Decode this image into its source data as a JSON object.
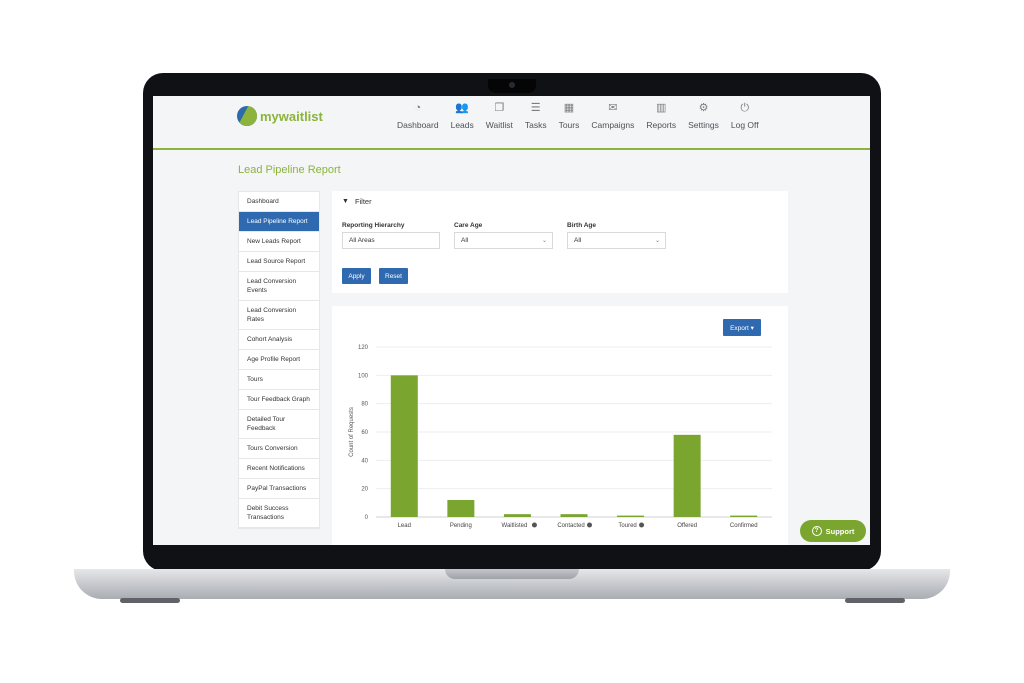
{
  "app": {
    "brand": "mywaitlist",
    "accent_color": "#8cb33c",
    "primary_color": "#2f6ab1"
  },
  "nav": [
    {
      "label": "Dashboard",
      "icon": "dashboard-icon",
      "glyph": "◔"
    },
    {
      "label": "Leads",
      "icon": "users-icon",
      "glyph": "👥"
    },
    {
      "label": "Waitlist",
      "icon": "copy-icon",
      "glyph": "❐"
    },
    {
      "label": "Tasks",
      "icon": "list-icon",
      "glyph": "☰"
    },
    {
      "label": "Tours",
      "icon": "calendar-icon",
      "glyph": "▦"
    },
    {
      "label": "Campaigns",
      "icon": "envelope-icon",
      "glyph": "✉"
    },
    {
      "label": "Reports",
      "icon": "bar-chart-icon",
      "glyph": "▥"
    },
    {
      "label": "Settings",
      "icon": "gears-icon",
      "glyph": "⚙"
    },
    {
      "label": "Log Off",
      "icon": "power-icon",
      "glyph": "⏻"
    }
  ],
  "page_title": "Lead Pipeline Report",
  "sidebar": [
    {
      "label": "Dashboard",
      "active": false
    },
    {
      "label": "Lead Pipeline Report",
      "active": true
    },
    {
      "label": "New Leads Report",
      "active": false
    },
    {
      "label": "Lead Source Report",
      "active": false
    },
    {
      "label": "Lead Conversion Events",
      "active": false
    },
    {
      "label": "Lead Conversion Rates",
      "active": false
    },
    {
      "label": "Cohort Analysis",
      "active": false
    },
    {
      "label": "Age Profile Report",
      "active": false
    },
    {
      "label": "Tours",
      "active": false
    },
    {
      "label": "Tour Feedback Graph",
      "active": false
    },
    {
      "label": "Detailed Tour Feedback",
      "active": false
    },
    {
      "label": "Tours Conversion",
      "active": false
    },
    {
      "label": "Recent Notifications",
      "active": false
    },
    {
      "label": "PayPal Transactions",
      "active": false
    },
    {
      "label": "Debit Success Transactions",
      "active": false
    }
  ],
  "filter": {
    "title": "Filter",
    "reporting_hierarchy_label": "Reporting Hierarchy",
    "reporting_hierarchy_value": "All Areas",
    "care_age_label": "Care Age",
    "care_age_value": "All",
    "birth_age_label": "Birth Age",
    "birth_age_value": "All",
    "apply_label": "Apply",
    "reset_label": "Reset"
  },
  "export_label": "Export ▾",
  "support_label": "Support",
  "chart_data": {
    "type": "bar",
    "categories": [
      "Lead",
      "Pending",
      "Waitlisted",
      "Contacted",
      "Toured",
      "Offered",
      "Confirmed"
    ],
    "category_info_icons": [
      false,
      false,
      true,
      true,
      true,
      false,
      false
    ],
    "values": [
      100,
      12,
      2,
      2,
      1,
      58,
      1
    ],
    "ylabel": "Count of Requests",
    "ylim": [
      0,
      120
    ],
    "yticks": [
      0,
      20,
      40,
      60,
      80,
      100,
      120
    ],
    "bar_color": "#7aa630",
    "grid": true
  }
}
